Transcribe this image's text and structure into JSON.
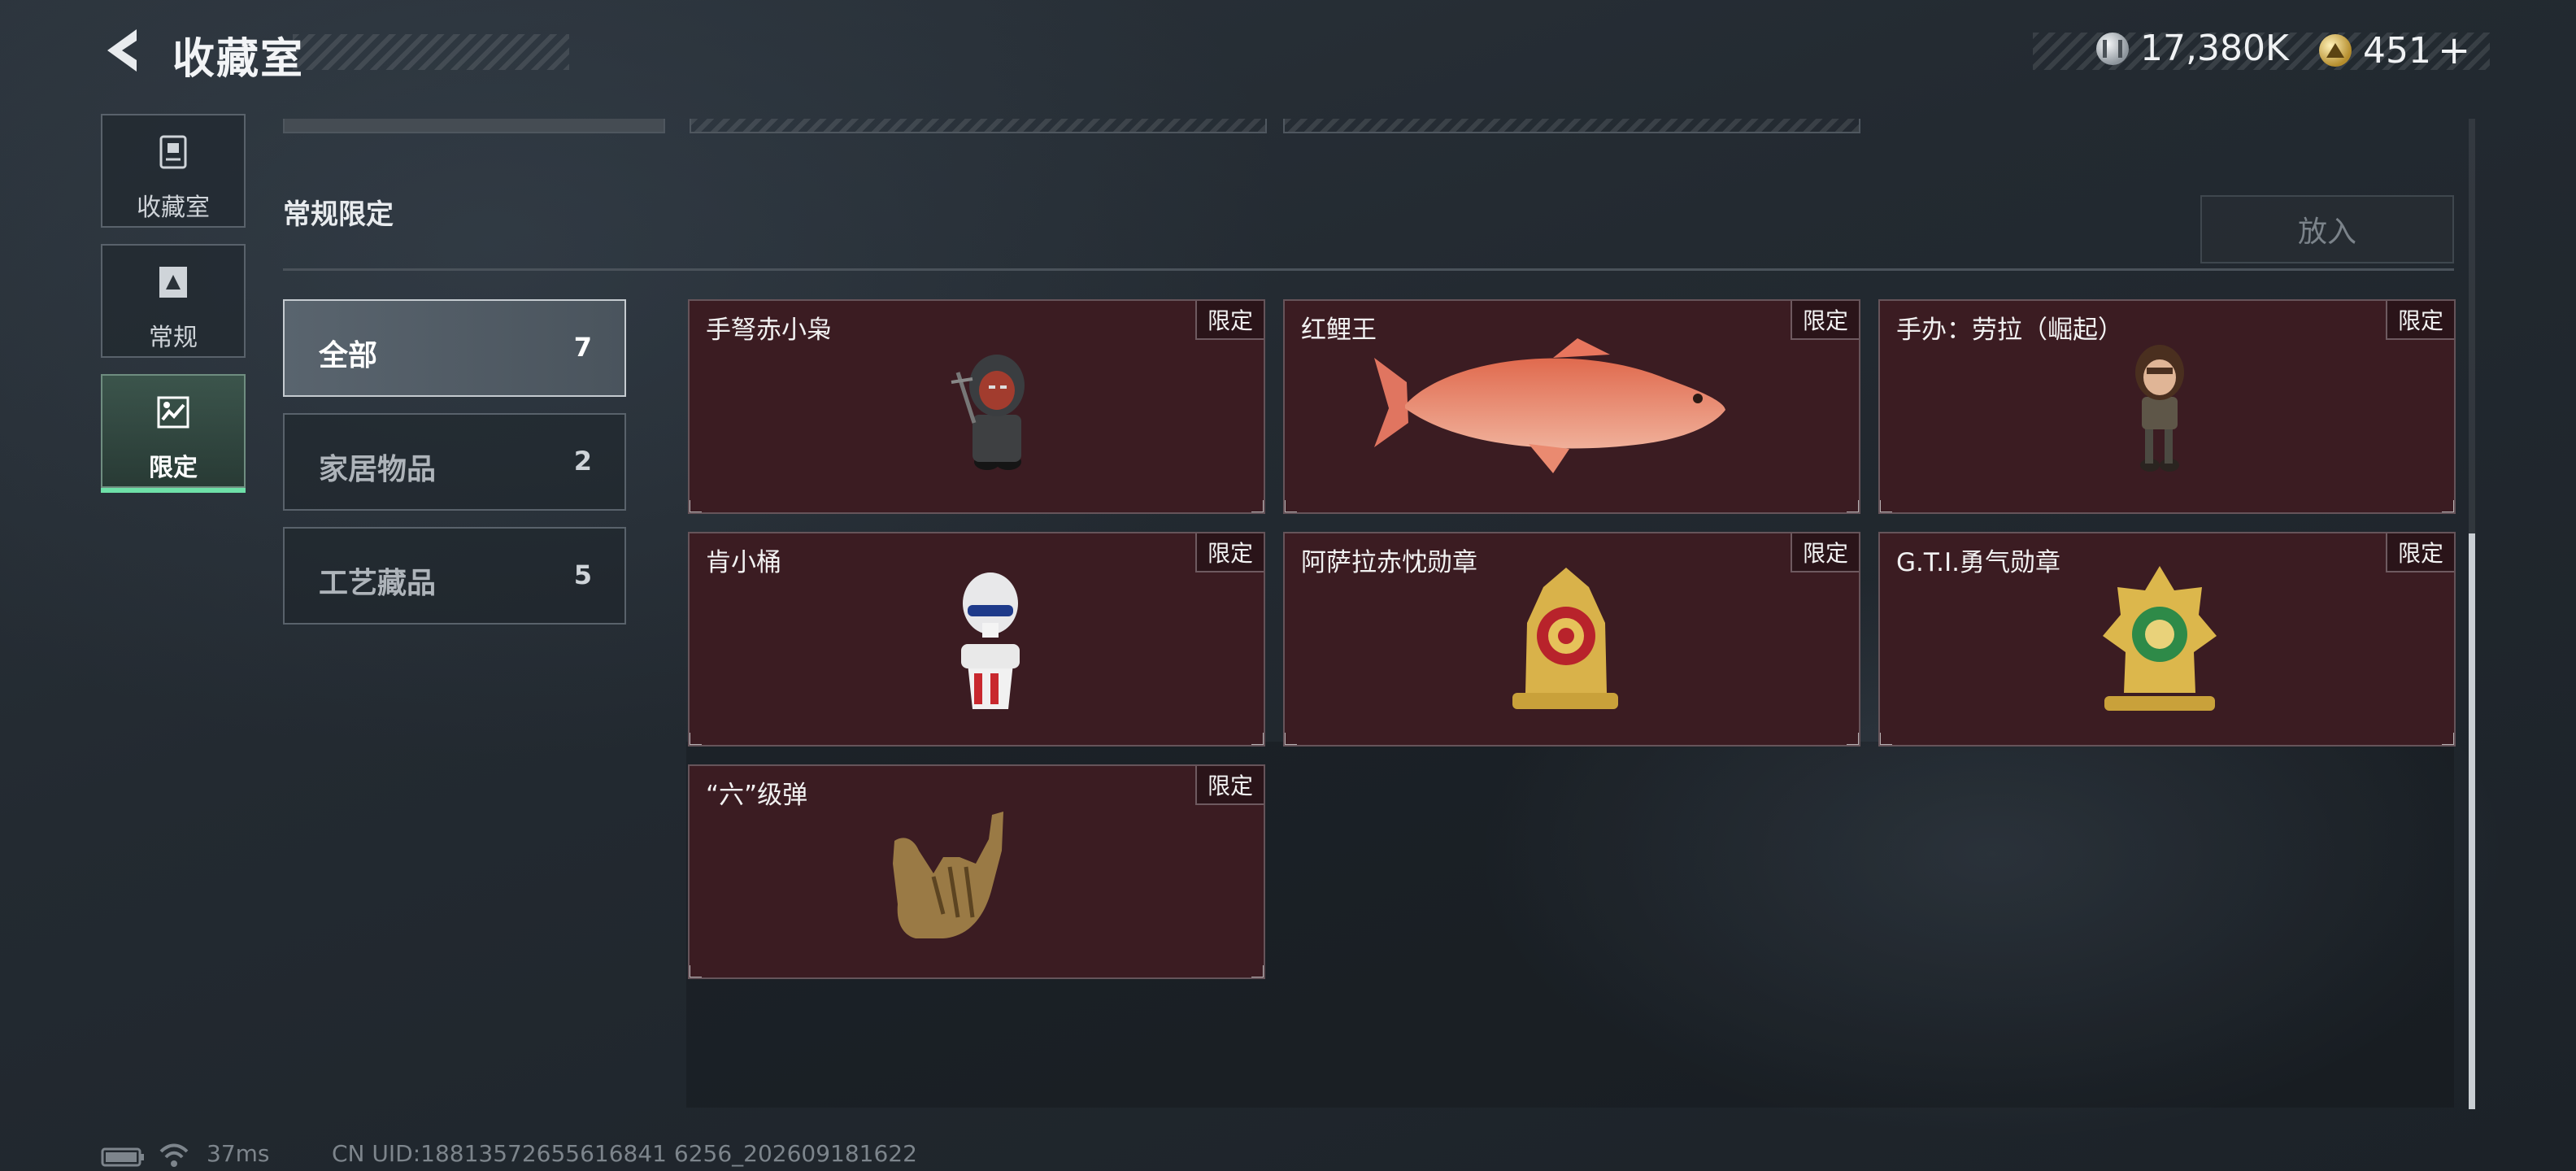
{
  "header": {
    "title": "收藏室"
  },
  "currency": {
    "silver": "17,380K",
    "gold": "451",
    "add_label": "+"
  },
  "nav": [
    {
      "label": "收藏室",
      "icon": "trash-bin-icon"
    },
    {
      "label": "常规",
      "icon": "document-icon"
    },
    {
      "label": "限定",
      "icon": "limited-icon"
    }
  ],
  "section": {
    "title": "常规限定",
    "put_button": "放入"
  },
  "categories": [
    {
      "label": "全部",
      "count": "7"
    },
    {
      "label": "家居物品",
      "count": "2"
    },
    {
      "label": "工艺藏品",
      "count": "5"
    }
  ],
  "items": [
    {
      "name": "手弩赤小枭",
      "tag": "限定",
      "icon": "crossbow-figure-icon"
    },
    {
      "name": "红鲤王",
      "tag": "限定",
      "icon": "red-carp-icon"
    },
    {
      "name": "手办：劳拉（崛起）",
      "tag": "限定",
      "icon": "lara-figure-icon"
    },
    {
      "name": "肯小桶",
      "tag": "限定",
      "icon": "kfc-bucket-figure-icon"
    },
    {
      "name": "阿萨拉赤忱勋章",
      "tag": "限定",
      "icon": "asara-medal-icon"
    },
    {
      "name": "G.T.I.勇气勋章",
      "tag": "限定",
      "icon": "gti-medal-icon"
    },
    {
      "name": "“六”级弹",
      "tag": "限定",
      "icon": "hand-sign-icon"
    }
  ],
  "status": {
    "ping": "37ms",
    "uid": "CN UID:18813572655616841 6256_202609181622"
  },
  "colors": {
    "accent": "#6ee0a8",
    "card_bg": "#3b1c22",
    "card_border": "#66545a"
  }
}
